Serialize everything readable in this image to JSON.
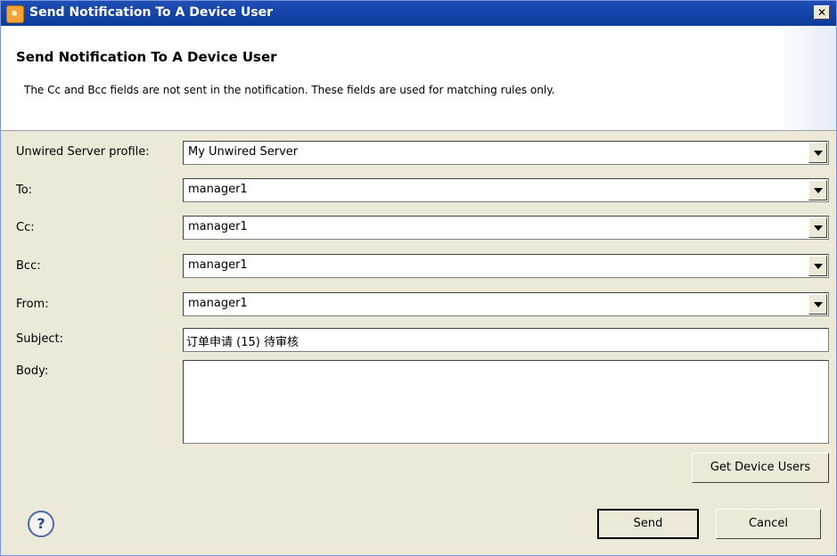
{
  "window": {
    "title": "Send Notification To A Device User",
    "close_glyph": "✕"
  },
  "header": {
    "title": "Send Notification To A Device User",
    "description": "The Cc and Bcc fields are not sent in the notification.  These fields are used for matching rules only."
  },
  "form": {
    "profile": {
      "label": "Unwired Server profile:",
      "value": "My Unwired Server"
    },
    "to": {
      "label": "To:",
      "value": "manager1"
    },
    "cc": {
      "label": "Cc:",
      "value": "manager1"
    },
    "bcc": {
      "label": "Bcc:",
      "value": "manager1"
    },
    "from": {
      "label": "From:",
      "value": "manager1"
    },
    "subject": {
      "label": "Subject:",
      "value": "订单申请 (15) 待审核"
    },
    "body": {
      "label": "Body:",
      "value": ""
    }
  },
  "buttons": {
    "get_device_users": "Get Device Users",
    "send": "Send",
    "cancel": "Cancel",
    "help": "?"
  },
  "icons": {
    "app": "app-logo-icon",
    "close": "close-icon",
    "dropdown": "chevron-down-icon",
    "help": "help-icon"
  }
}
